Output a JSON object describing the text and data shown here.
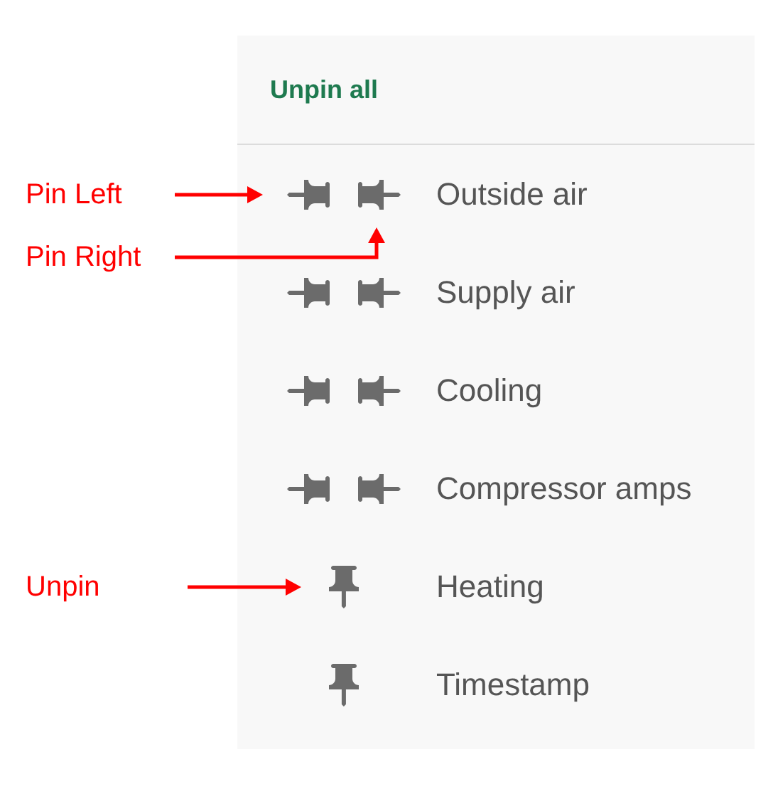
{
  "panel": {
    "unpin_all": "Unpin all",
    "columns": [
      {
        "label": "Outside air",
        "pinned": false
      },
      {
        "label": "Supply air",
        "pinned": false
      },
      {
        "label": "Cooling",
        "pinned": false
      },
      {
        "label": "Compressor amps",
        "pinned": false
      },
      {
        "label": "Heating",
        "pinned": true
      },
      {
        "label": "Timestamp",
        "pinned": true
      }
    ]
  },
  "annotations": [
    {
      "text": "Pin Left",
      "kind": "straight"
    },
    {
      "text": "Pin Right",
      "kind": "elbow"
    },
    {
      "text": "Unpin",
      "kind": "straight"
    }
  ]
}
